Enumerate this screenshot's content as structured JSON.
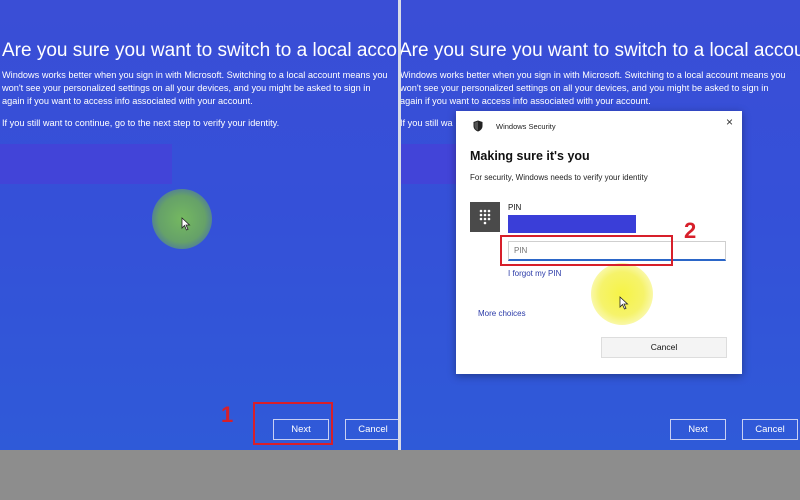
{
  "left_panel": {
    "heading": "Are you sure you want to switch to a local account?",
    "body": "Windows works better when you sign in with Microsoft. Switching to a local account means you won't see your personalized settings on all your devices, and you might be asked to sign in again if you want to access info associated with your account.",
    "note": "If you still want to continue, go to the next step to verify your identity.",
    "next_label": "Next",
    "cancel_label": "Cancel",
    "step_number": "1"
  },
  "right_panel": {
    "heading": "Are you sure you want to switch to a local account?",
    "body": "Windows works better when you sign in with Microsoft. Switching to a local account means you won't see your personalized settings on all your devices, and you might be asked to sign in again if you want to access info associated with your account.",
    "note": "If you still wa",
    "next_label": "Next",
    "cancel_label": "Cancel",
    "step_number": "2"
  },
  "dialog": {
    "window_title": "Windows Security",
    "close_glyph": "×",
    "heading": "Making sure it's you",
    "subtitle": "For security, Windows needs to verify your identity",
    "pin_label": "PIN",
    "pin_placeholder": "PIN",
    "forgot_link": "I forgot my PIN",
    "more_choices": "More choices",
    "cancel_label": "Cancel"
  },
  "colors": {
    "background_blue": "#3550d8",
    "highlight_red": "#d71f2a",
    "cursor_glow_green": "#6fae5a",
    "cursor_glow_yellow": "#f2f03a"
  },
  "icons": [
    "shield-icon",
    "close-icon",
    "pin-keypad-icon",
    "mouse-cursor-icon"
  ]
}
